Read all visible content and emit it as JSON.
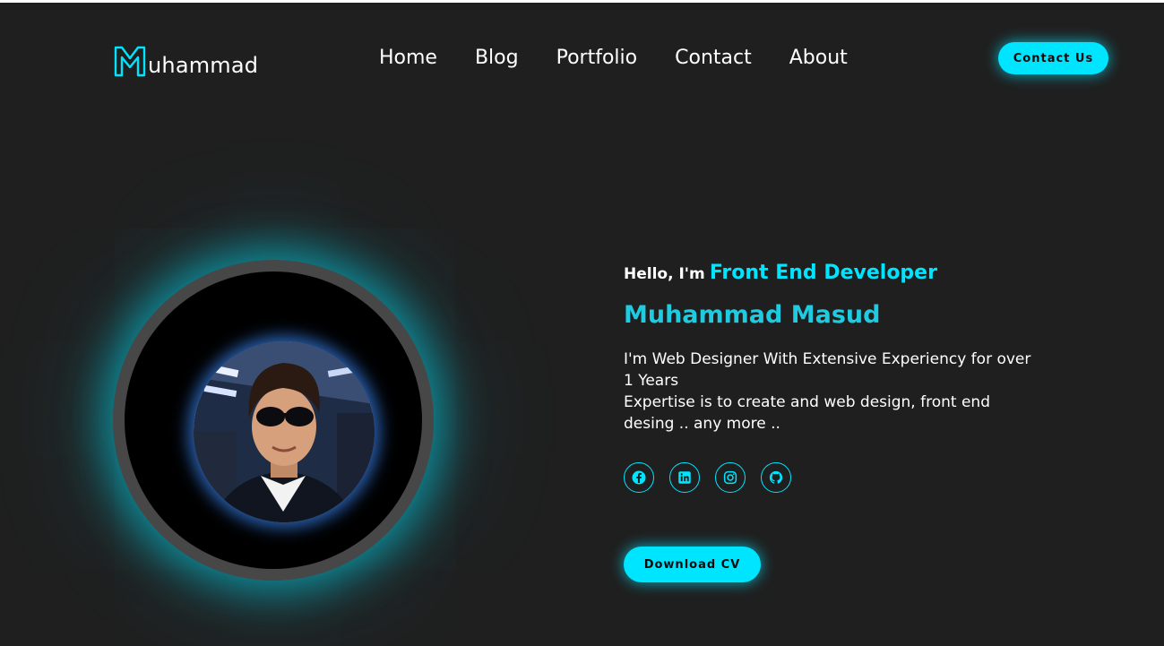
{
  "header": {
    "logo_text": "uhammad",
    "logo_letter": "M",
    "nav": [
      {
        "label": "Home"
      },
      {
        "label": "Blog"
      },
      {
        "label": "Portfolio"
      },
      {
        "label": "Contact"
      },
      {
        "label": "About"
      }
    ],
    "contact_button": "Contact Us"
  },
  "hero": {
    "greeting": "Hello, I'm",
    "role": "Front End Developer",
    "name": "Muhammad Masud",
    "description_lines": [
      "I'm Web Designer With Extensive Experiency for over 1 Years",
      "Expertise is to create and web design, front end desing .. any more .."
    ],
    "socials": [
      {
        "icon": "facebook-icon"
      },
      {
        "icon": "linkedin-icon"
      },
      {
        "icon": "instagram-icon"
      },
      {
        "icon": "github-icon"
      }
    ],
    "download_button": "Download CV"
  },
  "colors": {
    "background": "#1f1f1f",
    "accent": "#00e5ff",
    "name": "#1ecbe1"
  }
}
